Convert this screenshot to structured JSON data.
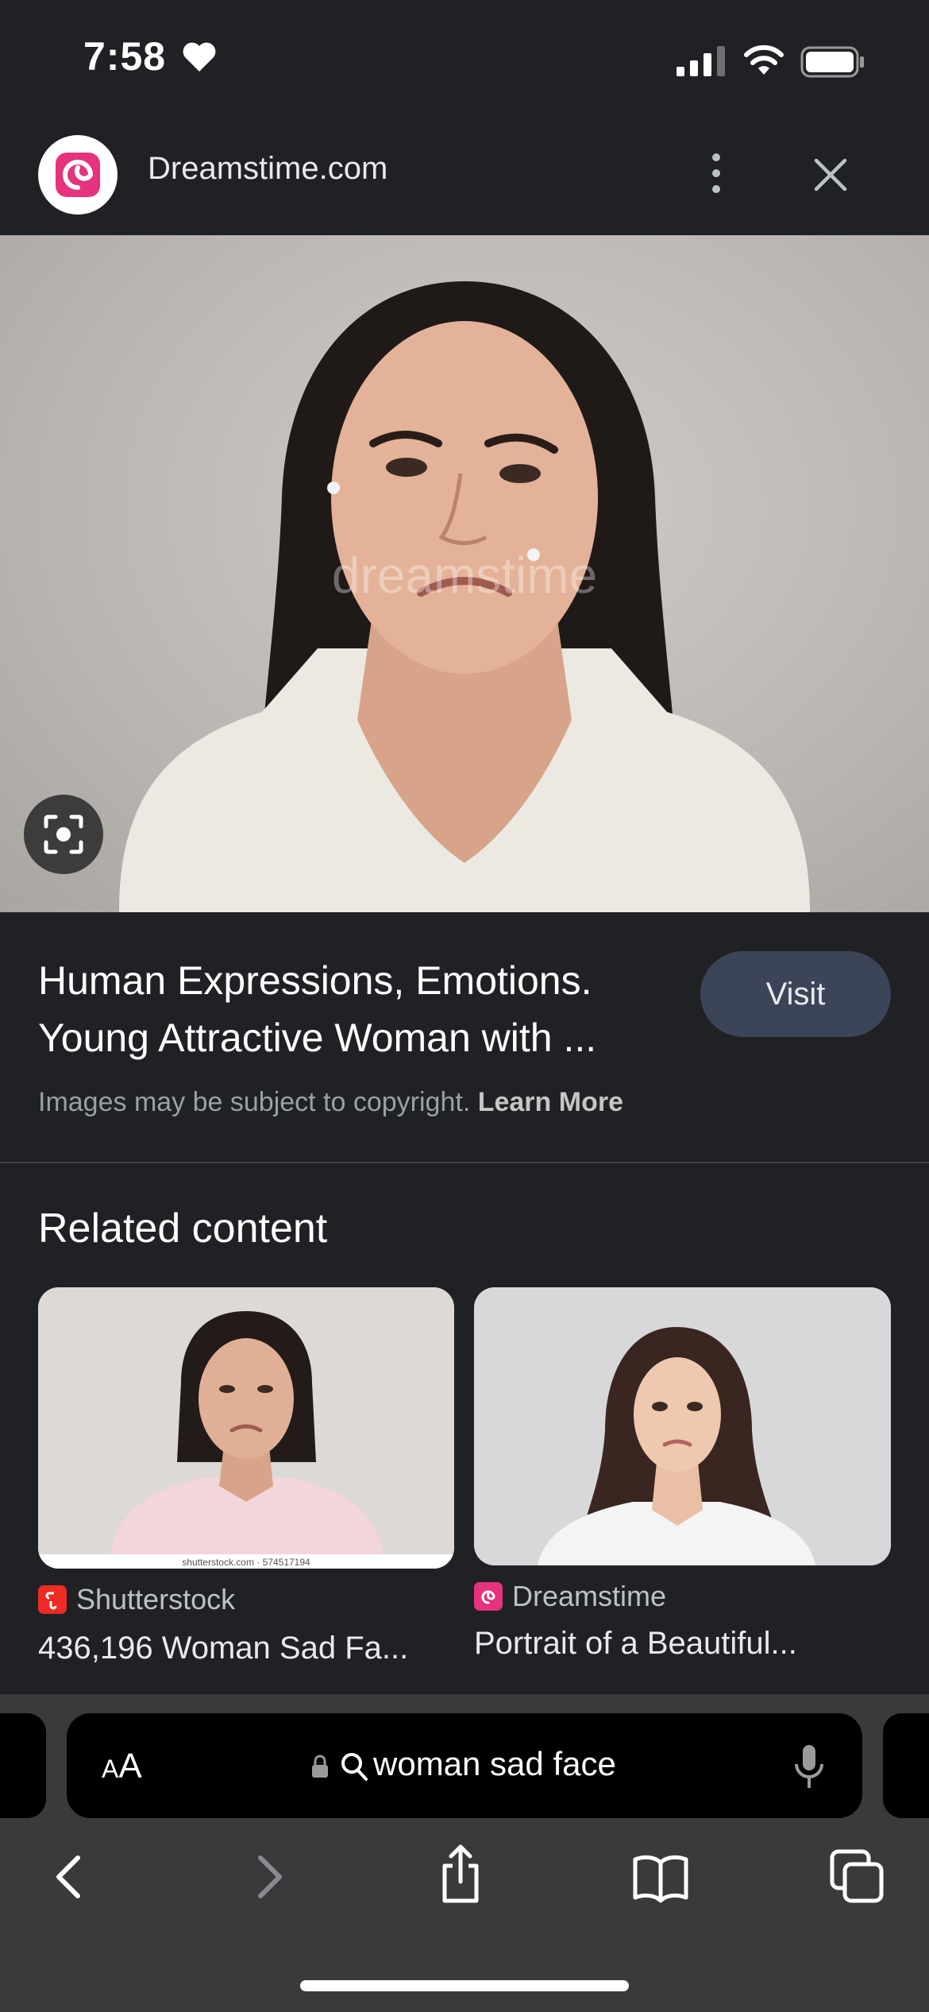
{
  "status_bar": {
    "time": "7:58"
  },
  "header": {
    "site_name": "Dreamstime.com"
  },
  "result": {
    "title_line1": "Human Expressions, Emotions.",
    "title_line2": "Young Attractive Woman with ...",
    "visit_label": "Visit",
    "copyright_text": "Images may be subject to copyright.",
    "learn_more_label": "Learn More",
    "watermark": "dreamstime"
  },
  "related": {
    "heading": "Related content",
    "cards": [
      {
        "source": "Shutterstock",
        "title": "436,196 Woman Sad Fa...",
        "caption": "shutterstock.com · 574517194"
      },
      {
        "source": "Dreamstime",
        "title": "Portrait of a Beautiful..."
      }
    ]
  },
  "browser": {
    "aa_small": "A",
    "aa_large": "A",
    "address_text": "woman sad face"
  },
  "icons": {
    "heart": "heart-icon",
    "signal": "signal-icon",
    "wifi": "wifi-icon",
    "battery": "battery-icon",
    "more": "more-vertical-icon",
    "close": "close-icon",
    "lens": "lens-icon",
    "lock": "lock-icon",
    "search": "search-icon",
    "mic": "microphone-icon",
    "back": "chevron-left-icon",
    "forward": "chevron-right-icon",
    "share": "share-icon",
    "bookmarks": "book-icon",
    "tabs": "tabs-icon"
  },
  "colors": {
    "background": "#202124",
    "visit_button": "#3c4458",
    "dreamstime_brand": "#e5337d",
    "shutterstock_brand": "#ee2b24"
  }
}
